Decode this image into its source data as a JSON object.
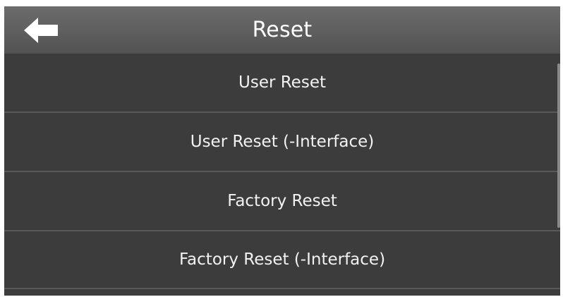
{
  "header": {
    "title": "Reset",
    "back_icon": "left-arrow-icon"
  },
  "menu": {
    "items": [
      {
        "label": "User Reset"
      },
      {
        "label": "User Reset (-Interface)"
      },
      {
        "label": "Factory Reset"
      },
      {
        "label": "Factory Reset (-Interface)"
      }
    ]
  },
  "colors": {
    "header_bg": "#5e5e5e",
    "list_bg": "#3c3c3c",
    "divider": "#5a5a5a",
    "text": "#f2f2f2"
  }
}
